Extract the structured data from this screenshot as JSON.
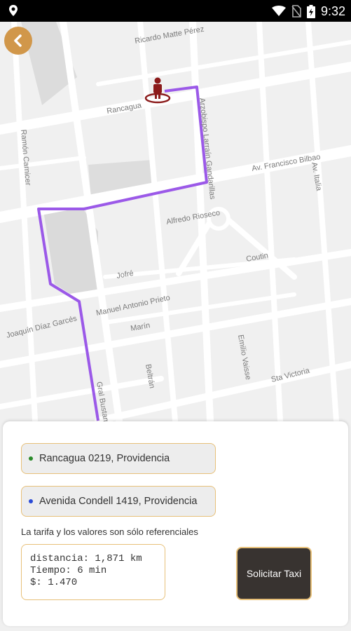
{
  "status_bar": {
    "time": "9:32"
  },
  "map": {
    "streets": [
      "Ricardo Matte Pérez",
      "Rancagua",
      "Ramón Carnicer",
      "Arzobispo Larraín Gandarillas",
      "Av. Francisco Bilbao",
      "Av. Italia",
      "Alfredo Rioseco",
      "Coutin",
      "Jofré",
      "Manuel Antonio Prieto",
      "Marín",
      "Joaquín Díaz Garcés",
      "Emilio Vaisse",
      "Beltrán",
      "Sta Victoria",
      "Gral Bustamante"
    ],
    "route_color": "#9b59e8"
  },
  "back_button": {
    "icon": "chevron-left-icon",
    "color": "#d1974a"
  },
  "panel": {
    "origin": {
      "text": "Rancagua 0219, Providencia",
      "dot_color": "#2a8a2a"
    },
    "destination": {
      "text": "Avenida Condell 1419, Providencia",
      "dot_color": "#2a4ad6"
    },
    "note": "La tarifa y los valores son sólo referenciales",
    "info_lines": [
      "distancia: 1,871 km",
      "Tiempo: 6 min",
      "$: 1.470"
    ],
    "request_button": "Solicitar Taxi"
  }
}
